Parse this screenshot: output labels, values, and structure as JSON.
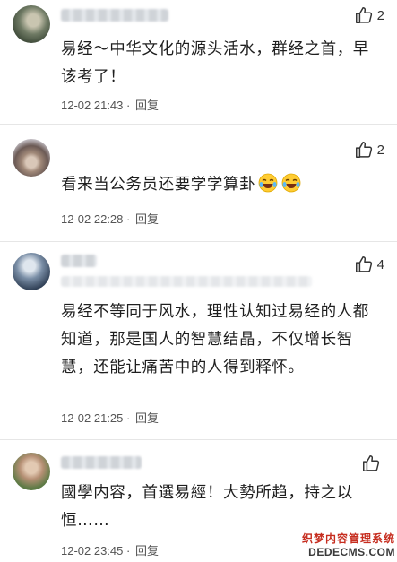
{
  "comments": [
    {
      "likes": "2",
      "text": "易经～中华文化的源头活水，群经之首，早该考了！",
      "time": "12-02 21:43",
      "reply": "回复"
    },
    {
      "likes": "2",
      "text": "看来当公务员还要学学算卦",
      "time": "12-02 22:28",
      "reply": "回复"
    },
    {
      "likes": "4",
      "text": "易经不等同于风水，理性认知过易经的人都知道，那是国人的智慧结晶，不仅增长智慧，还能让痛苦中的人得到释怀。",
      "time": "12-02 21:25",
      "reply": "回复"
    },
    {
      "likes": "",
      "text": "國學内容，首選易經！大勢所趋，持之以恒……",
      "time": "12-02 23:45",
      "reply": "回复"
    }
  ],
  "watermark": {
    "line1": "织梦内容管理系统",
    "line2": "DEDECMS.COM"
  },
  "icons": {
    "like": "thumbs-up-icon",
    "emoji": "laughing-crying-emoji-icon"
  }
}
